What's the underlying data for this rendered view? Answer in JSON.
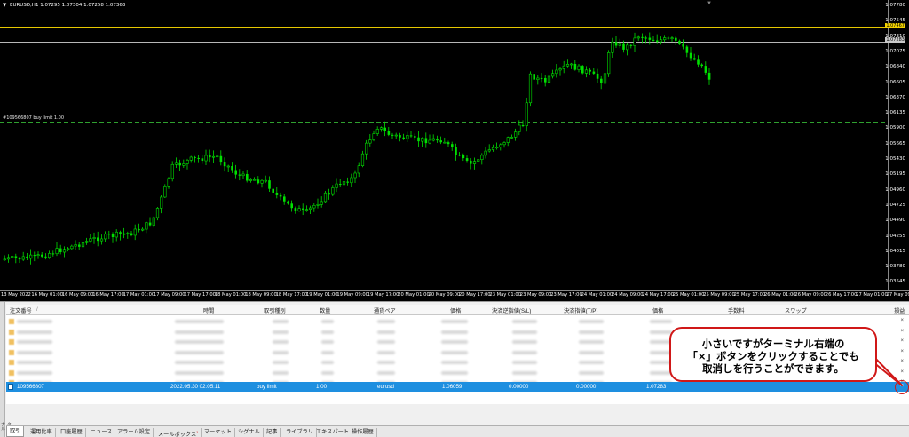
{
  "chart": {
    "symbol_line": "EURUSD,H1  1.07295 1.07304 1.07258 1.07363",
    "order_line_label": "#109566807 buy limit 1.00",
    "price_axis": [
      "1.07780",
      "1.07545",
      "1.07310",
      "1.07075",
      "1.06840",
      "1.06605",
      "1.06370",
      "1.06135",
      "1.05900",
      "1.05665",
      "1.05430",
      "1.05195",
      "1.04960",
      "1.04725",
      "1.04490",
      "1.04255",
      "1.04015",
      "1.03780",
      "1.03545"
    ],
    "price_tag_yellow": "1.07467",
    "price_tag_gray": "1.07283",
    "time_axis": [
      "13 May 2022",
      "16 May 01:00",
      "16 May 09:00",
      "16 May 17:00",
      "17 May 01:00",
      "17 May 09:00",
      "17 May 17:00",
      "18 May 01:00",
      "18 May 09:00",
      "18 May 17:00",
      "19 May 01:00",
      "19 May 09:00",
      "19 May 17:00",
      "20 May 01:00",
      "20 May 09:00",
      "20 May 17:00",
      "23 May 01:00",
      "23 May 09:00",
      "23 May 17:00",
      "24 May 01:00",
      "24 May 09:00",
      "24 May 17:00",
      "25 May 01:00",
      "25 May 09:00",
      "25 May 17:00",
      "26 May 01:00",
      "26 May 09:00",
      "26 May 17:00",
      "27 May 01:00",
      "27 May 09:00"
    ],
    "colors": {
      "background": "#000000",
      "candle": "#00e000",
      "ask_line": "#e6c800",
      "bid_line": "#b8b8b8",
      "order_line": "#2fa02f"
    }
  },
  "terminal": {
    "columns": [
      "注文番号",
      "時間",
      "取引種別",
      "数量",
      "通貨ペア",
      "価格",
      "決済逆指値(S/L)",
      "決済指値(T/P)",
      "価格",
      "手数料",
      "スワップ",
      "損益"
    ],
    "sort_arrow": "/",
    "blurred_row_count": 7,
    "close_symbol": "×",
    "selected_order": {
      "ticket": "109566807",
      "time": "2022.05.30 02:05:11",
      "type": "buy limit",
      "volume": "1.00",
      "symbol": "eurusd",
      "price": "1.06059",
      "sl": "0.00000",
      "tp": "0.00000",
      "current_price": "1.07283"
    },
    "side_label": "ターミナル",
    "tabs": [
      {
        "label": "取引",
        "active": true
      },
      {
        "label": "運用比率",
        "active": false
      },
      {
        "label": "口座履歴",
        "active": false
      },
      {
        "label": "ニュース",
        "active": false
      },
      {
        "label": "アラーム設定",
        "active": false
      },
      {
        "label": "メールボックス",
        "active": false,
        "badge": "1"
      },
      {
        "label": "マーケット",
        "active": false
      },
      {
        "label": "シグナル",
        "active": false
      },
      {
        "label": "記事",
        "active": false
      },
      {
        "label": "ライブラリ",
        "active": false
      },
      {
        "label": "エキスパート",
        "active": false
      },
      {
        "label": "操作履歴",
        "active": false
      }
    ]
  },
  "annotation": {
    "line1": "小さいですがターミナル右端の",
    "line2": "「×」ボタンをクリックすることでも",
    "line3": "取消しを行うことができます。",
    "border_color": "#d01818"
  }
}
